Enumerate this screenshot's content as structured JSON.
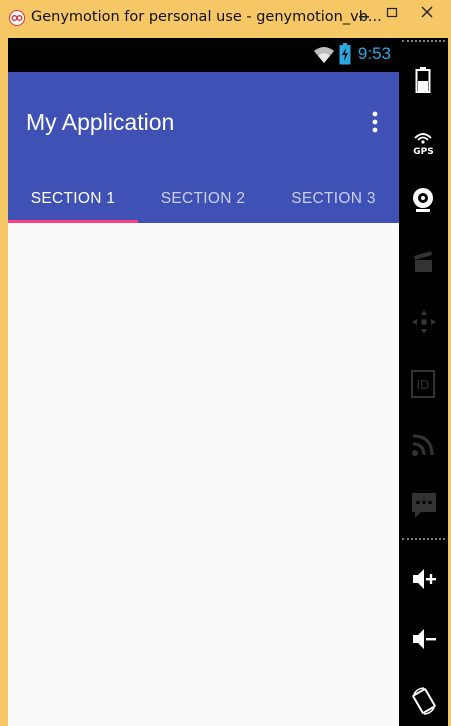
{
  "window": {
    "title": "Genymotion for personal use - genymotion_vb...",
    "icon": "genymotion-logo-icon",
    "buttons": [
      "minimize-icon",
      "maximize-icon",
      "close-icon"
    ]
  },
  "statusbar": {
    "time": "9:53",
    "icons": [
      "wifi-icon",
      "battery-charging-icon"
    ]
  },
  "appbar": {
    "title": "My Application",
    "overflow_icon": "more-vert-icon",
    "color": "#3f51b5"
  },
  "tabs": [
    {
      "label": "SECTION 1",
      "selected": true
    },
    {
      "label": "SECTION 2",
      "selected": false
    },
    {
      "label": "SECTION 3",
      "selected": false
    }
  ],
  "tab_indicator_color": "#ff4081",
  "sidebar": {
    "gps_label": "GPS",
    "items": [
      "battery-icon",
      "gps-icon",
      "webcam-icon",
      "media-icon",
      "dpad-icon",
      "id-icon",
      "cast-icon",
      "sms-icon",
      "volume-up-icon",
      "volume-down-icon",
      "rotate-icon"
    ]
  }
}
